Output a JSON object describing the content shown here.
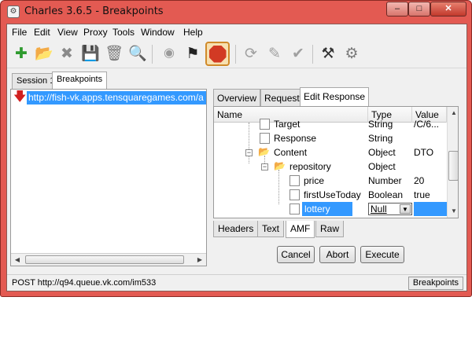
{
  "window": {
    "title": "Charles 3.6.5 - Breakpoints"
  },
  "menu": [
    "File",
    "Edit",
    "View",
    "Proxy",
    "Tools",
    "Window",
    "Help"
  ],
  "toolbar": {
    "icons": [
      "new-session-icon",
      "open-session-icon",
      "close-session-icon",
      "save-session-icon",
      "clear-session-icon",
      "find-icon",
      "record-icon",
      "throttle-flag-icon",
      "breakpoints-stop-icon",
      "repeat-icon",
      "edit-icon",
      "validate-icon",
      "tools-icon",
      "settings-gear-icon"
    ]
  },
  "sessions": {
    "tabs": [
      "Session 1",
      "Breakpoints"
    ],
    "selected": "Breakpoints"
  },
  "tree": {
    "url": "http://fish-vk.apps.tensquaregames.com/a"
  },
  "detail": {
    "tabs": [
      "Overview",
      "Request",
      "Edit Response"
    ],
    "selected": "Edit Response",
    "columns": {
      "name": "Name",
      "type": "Type",
      "value": "Value"
    },
    "rows": [
      {
        "name": "Target",
        "type": "String",
        "value": "/C/6..."
      },
      {
        "name": "Response",
        "type": "String",
        "value": ""
      },
      {
        "name": "Content",
        "type": "Object",
        "value": "DTO"
      },
      {
        "name": "repository",
        "type": "Object",
        "value": ""
      },
      {
        "name": "price",
        "type": "Number",
        "value": "20"
      },
      {
        "name": "firstUseToday",
        "type": "Boolean",
        "value": "true"
      },
      {
        "name": "lottery",
        "type": "Null",
        "value": ""
      }
    ],
    "sub_tabs": [
      "Headers",
      "Text",
      "AMF",
      "Raw"
    ],
    "selected_sub_tab": "AMF",
    "buttons": {
      "cancel": "Cancel",
      "abort": "Abort",
      "execute": "Execute"
    }
  },
  "status": {
    "text": "POST http://q94.queue.vk.com/im533",
    "breakpoints": "Breakpoints"
  },
  "colors": {
    "titlebar": "#e35a52",
    "selection": "#3399ff"
  }
}
